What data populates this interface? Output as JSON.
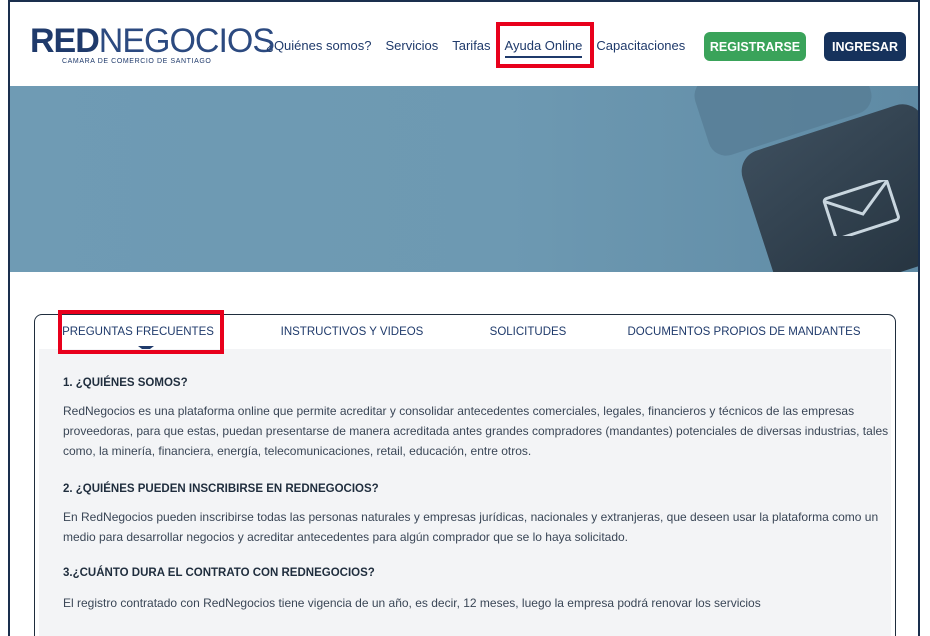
{
  "logo": {
    "main_bold": "RED",
    "main_light": "NEGOCIOS",
    "sub": "CAMARA DE COMERCIO DE SANTIAGO"
  },
  "nav": {
    "items": [
      {
        "label": "¿Quiénes somos?"
      },
      {
        "label": "Servicios"
      },
      {
        "label": "Tarifas"
      },
      {
        "label": "Ayuda Online",
        "active": true
      },
      {
        "label": "Capacitaciones"
      }
    ],
    "register_label": "REGISTRARSE",
    "login_label": "INGRESAR"
  },
  "tabs": [
    {
      "label": "PREGUNTAS FRECUENTES",
      "active": true
    },
    {
      "label": "INSTRUCTIVOS Y VIDEOS"
    },
    {
      "label": "SOLICITUDES"
    },
    {
      "label": "DOCUMENTOS PROPIOS DE MANDANTES"
    }
  ],
  "faq": [
    {
      "question": "1. ¿QUIÉNES SOMOS?",
      "answer": "RedNegocios es una plataforma online que permite acreditar y consolidar antecedentes comerciales, legales, financieros y técnicos de las empresas proveedoras, para que estas, puedan presentarse de manera acreditada antes grandes compradores (mandantes) potenciales de diversas industrias, tales como, la minería, financiera, energía, telecomunicaciones, retail, educación, entre otros."
    },
    {
      "question": "2. ¿QUIÉNES PUEDEN INSCRIBIRSE EN REDNEGOCIOS?",
      "answer": "En RedNegocios pueden inscribirse todas las personas naturales y empresas jurídicas, nacionales y extranjeras, que deseen usar la plataforma como un medio para desarrollar negocios y acreditar antecedentes para algún comprador que se lo haya solicitado."
    },
    {
      "question": "3.¿CUÁNTO DURA EL CONTRATO CON REDNEGOCIOS?",
      "answer": "El registro contratado con RedNegocios tiene vigencia de un año, es decir, 12 meses, luego la empresa podrá renovar los servicios"
    }
  ],
  "colors": {
    "brand_navy": "#1f3a6b",
    "register_green": "#3aa35a",
    "login_navy": "#16325c",
    "highlight_red": "#e8001c",
    "banner_blue": "#6f9bb4"
  },
  "icons": [
    "envelope-icon"
  ]
}
